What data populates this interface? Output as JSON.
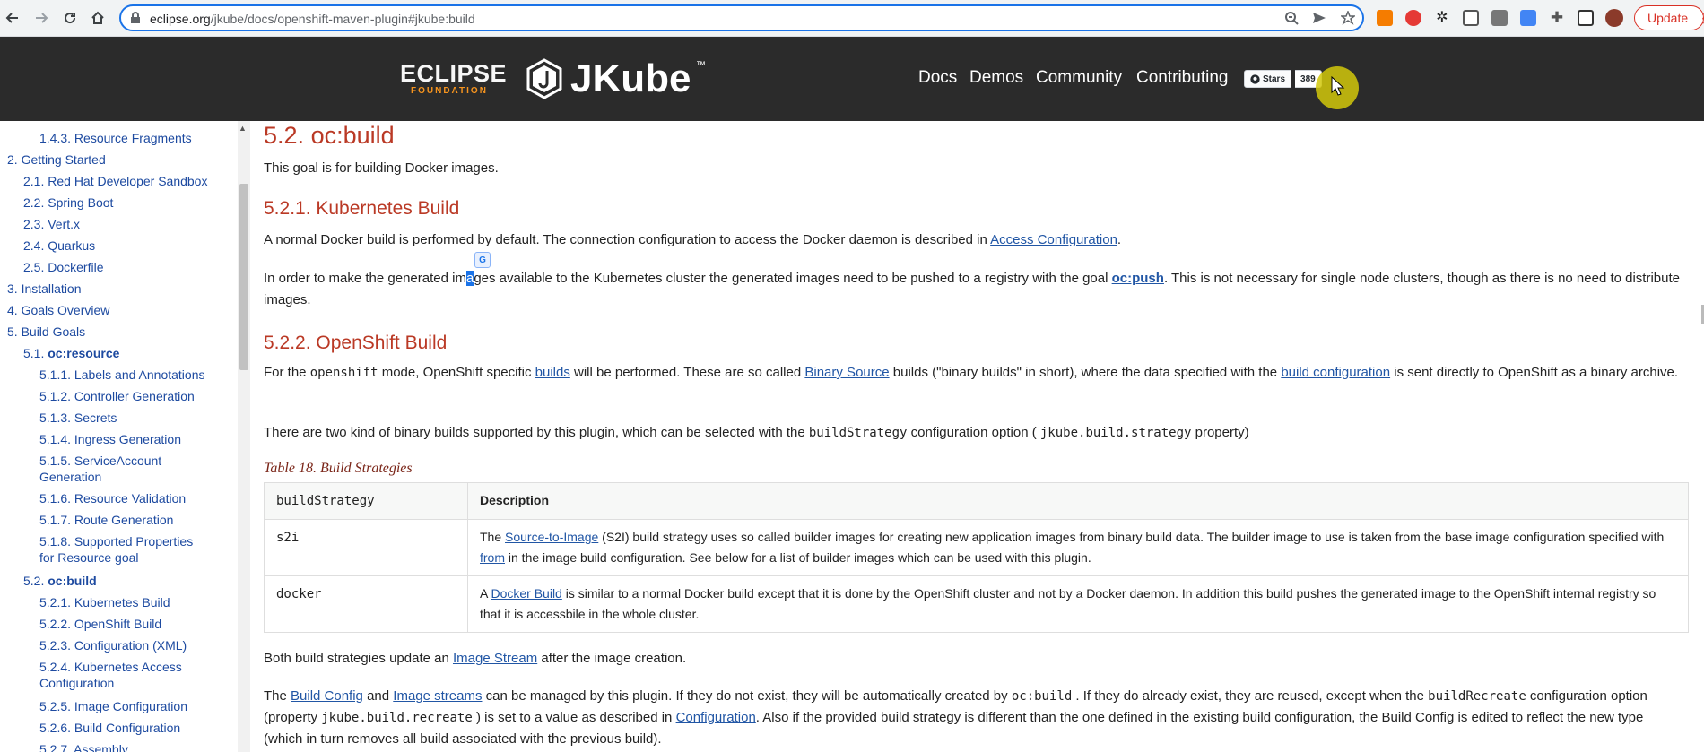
{
  "browser": {
    "url_host": "eclipse.org",
    "url_path": "/jkube/docs/openshift-maven-plugin#jkube:build",
    "update_label": "Update"
  },
  "header": {
    "eclipse_line1": "ECLIPSE",
    "eclipse_line2": "FOUNDATION",
    "brand": "JKube",
    "tm": "™",
    "nav": [
      "Docs",
      "Demos",
      "Community",
      "Contributing"
    ],
    "github_stars_label": "Stars",
    "github_stars_count": "389"
  },
  "sidebar": {
    "items": [
      {
        "label": "1.4.3. Resource Fragments"
      },
      {
        "label": "2. Getting Started"
      },
      {
        "label": "2.1. Red Hat Developer Sandbox"
      },
      {
        "label": "2.2. Spring Boot"
      },
      {
        "label": "2.3. Vert.x"
      },
      {
        "label": "2.4. Quarkus"
      },
      {
        "label": "2.5. Dockerfile"
      },
      {
        "label": "3. Installation"
      },
      {
        "label": "4. Goals Overview"
      },
      {
        "label": "5. Build Goals"
      },
      {
        "label": "5.1.",
        "bold": "oc:resource"
      },
      {
        "label": "5.1.1. Labels and Annotations"
      },
      {
        "label": "5.1.2. Controller Generation"
      },
      {
        "label": "5.1.3. Secrets"
      },
      {
        "label": "5.1.4. Ingress Generation"
      },
      {
        "label": "5.1.5. ServiceAccount",
        "label2": "Generation"
      },
      {
        "label": "5.1.6. Resource Validation"
      },
      {
        "label": "5.1.7. Route Generation"
      },
      {
        "label": "5.1.8. Supported Properties",
        "label2": "for Resource goal"
      },
      {
        "label": "5.2.",
        "bold": "oc:build"
      },
      {
        "label": "5.2.1. Kubernetes Build"
      },
      {
        "label": "5.2.2. OpenShift Build"
      },
      {
        "label": "5.2.3. Configuration (XML)"
      },
      {
        "label": "5.2.4. Kubernetes Access",
        "label2": "Configuration"
      },
      {
        "label": "5.2.5. Image Configuration"
      },
      {
        "label": "5.2.6. Build Configuration"
      },
      {
        "label": "5.2.7. Assembly"
      }
    ]
  },
  "content": {
    "h_num": "5.2.",
    "h_code": "oc:build",
    "intro": "This goal is for building Docker images.",
    "kb_title": "5.2.1. Kubernetes Build",
    "kb_p1_a": "A normal Docker build is performed by default. The connection configuration to access the Docker daemon is described in ",
    "kb_p1_link": "Access Configuration",
    "kb_p1_b": ".",
    "kb_p2_a": "In order to make the generated im",
    "kb_p2_hl": "a",
    "kb_p2_b": "ges available to the Kubernetes cluster the generated images need to be pushed to a registry with the goal ",
    "kb_p2_link": "oc:push",
    "kb_p2_c": ". This is not necessary for single node clusters, though as there is no need to distribute images.",
    "os_title": "5.2.2. OpenShift Build",
    "os_p1_a": "For the ",
    "os_p1_code": "openshift",
    "os_p1_b": " mode, OpenShift specific ",
    "os_p1_link1": "builds",
    "os_p1_c": " will be performed. These are so called ",
    "os_p1_link2": "Binary Source",
    "os_p1_d": " builds (\"binary builds\" in short), where the data specified with the ",
    "os_p1_link3": "build configuration",
    "os_p1_e": " is sent directly to OpenShift as a binary archive.",
    "os_p2_a": "There are two kind of binary builds supported by this plugin, which can be selected with the ",
    "os_p2_code1": "buildStrategy",
    "os_p2_b": " configuration option ( ",
    "os_p2_code2": "jkube.build.strategy",
    "os_p2_c": " property)",
    "table_caption": "Table 18. Build Strategies",
    "table_head": [
      "buildStrategy",
      "Description"
    ],
    "row1_key": "s2i",
    "row1_a": "The ",
    "row1_link1": "Source-to-Image",
    "row1_b": " (S2I) build strategy uses so called builder images for creating new application images from binary build data. The builder image to use is taken from the base image configuration specified with ",
    "row1_link2": "from",
    "row1_c": " in the image build configuration. See below for a list of builder images which can be used with this plugin.",
    "row2_key": "docker",
    "row2_a": "A ",
    "row2_link": "Docker Build",
    "row2_b": " is similar to a normal Docker build except that it is done by the OpenShift cluster and not by a Docker daemon. In addition this build pushes the generated image to the OpenShift internal registry so that it is accessbile in the whole cluster.",
    "p_both_a": "Both build strategies update an ",
    "p_both_link": "Image Stream",
    "p_both_b": " after the image creation.",
    "p_last_a": "The ",
    "p_last_link1": "Build Config",
    "p_last_b": " and ",
    "p_last_link2": "Image streams",
    "p_last_c": " can be managed by this plugin. If they do not exist, they will be automatically created by ",
    "p_last_code1": "oc:build",
    "p_last_d": " . If they do already exist, they are reused, except when the ",
    "p_last_code2": "buildRecreate",
    "p_last_e": " configuration option (property ",
    "p_last_code3": "jkube.build.recreate",
    "p_last_f": " ) is set to a value as described in ",
    "p_last_link3": "Configuration",
    "p_last_g": ". Also if the provided build strategy is different than the one defined in the existing build configuration, the Build Config is edited to reflect the new type (which in turn removes all build associated with the previous build)."
  }
}
